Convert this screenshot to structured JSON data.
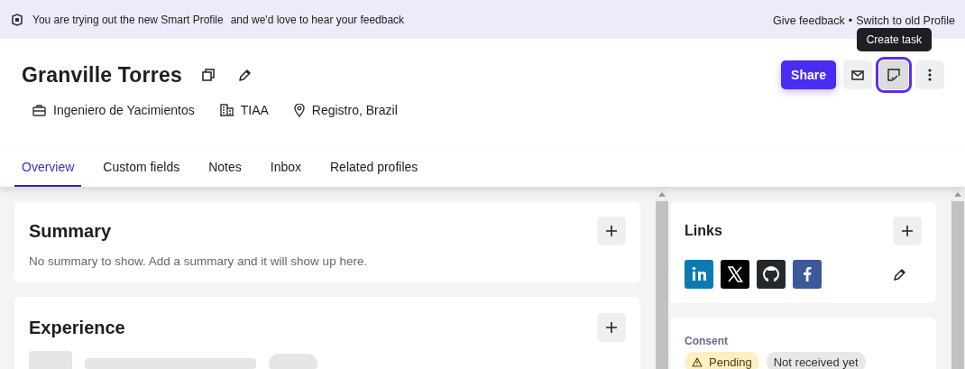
{
  "banner": {
    "message": "You are trying out the new Smart Profile",
    "submessage": "and we'd love to hear your feedback",
    "links": [
      "Give feedback",
      "Switch to old Profile"
    ],
    "separator": "•"
  },
  "profile": {
    "name": "Granville Torres",
    "meta": [
      {
        "kind": "job",
        "text": "Ingeniero de Yacimientos"
      },
      {
        "kind": "company",
        "text": "TIAA"
      },
      {
        "kind": "location",
        "text": "Registro, Brazil"
      }
    ]
  },
  "actions": [
    {
      "kind": "share",
      "label": "Share",
      "focused": false
    },
    {
      "kind": "email",
      "focused": false
    },
    {
      "kind": "task",
      "focused": true,
      "tooltip": "Create task"
    },
    {
      "kind": "more",
      "focused": false
    }
  ],
  "tabs": [
    {
      "label": "Overview",
      "selected": true
    },
    {
      "label": "Custom fields",
      "selected": false
    },
    {
      "label": "Notes",
      "selected": false
    },
    {
      "label": "Inbox",
      "selected": false
    },
    {
      "label": "Related profiles",
      "selected": false
    }
  ],
  "main_cards": [
    {
      "title": "Summary",
      "text": "No summary to show. Add a summary and it will show up here.",
      "loading": false
    },
    {
      "title": "Experience",
      "loading": true
    }
  ],
  "links_card": {
    "title": "Links",
    "links": [
      {
        "kind": "linkedin"
      },
      {
        "kind": "x"
      },
      {
        "kind": "github"
      },
      {
        "kind": "facebook"
      }
    ]
  },
  "consent": {
    "title": "Consent",
    "badges": [
      {
        "kind": "warning",
        "text": "Pending"
      },
      {
        "kind": "neutral",
        "text": "Not received yet"
      }
    ]
  }
}
